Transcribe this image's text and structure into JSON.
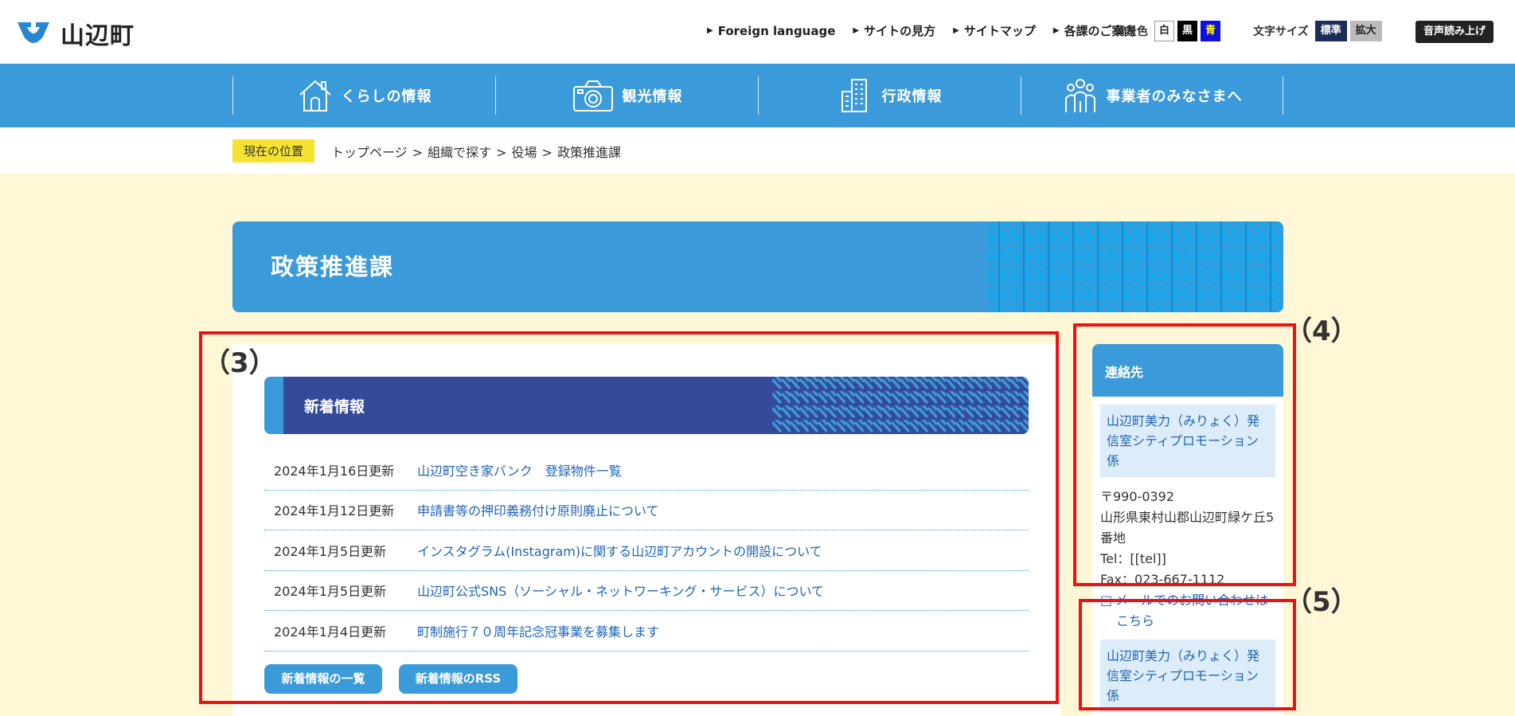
{
  "site": {
    "name": "山辺町"
  },
  "topnav": [
    {
      "label": "Foreign language"
    },
    {
      "label": "サイトの見方"
    },
    {
      "label": "サイトマップ"
    },
    {
      "label": "各課のご案内"
    }
  ],
  "bgcolor": {
    "label": "背景色",
    "white": "白",
    "black": "黒",
    "blue": "青"
  },
  "fontsize": {
    "label": "文字サイズ",
    "standard": "標準",
    "large": "拡大"
  },
  "voice": {
    "label": "音声読み上げ"
  },
  "globalnav": [
    {
      "label": "くらしの情報",
      "icon": "house-icon"
    },
    {
      "label": "観光情報",
      "icon": "camera-icon"
    },
    {
      "label": "行政情報",
      "icon": "building-icon"
    },
    {
      "label": "事業者のみなさまへ",
      "icon": "people-icon"
    }
  ],
  "breadcrumb": {
    "label": "現在の位置",
    "items": [
      "トップページ",
      "組織で探す",
      "役場",
      "政策推進課"
    ],
    "separator": ">"
  },
  "page": {
    "title": "政策推進課"
  },
  "news": {
    "title": "新着情報",
    "items": [
      {
        "date": "2024年1月16日更新",
        "title": "山辺町空き家バンク　登録物件一覧"
      },
      {
        "date": "2024年1月12日更新",
        "title": "申請書等の押印義務付け原則廃止について"
      },
      {
        "date": "2024年1月5日更新",
        "title": "インスタグラム(Instagram)に関する山辺町アカウントの開設について"
      },
      {
        "date": "2024年1月5日更新",
        "title": "山辺町公式SNS（ソーシャル・ネットワーキング・サービス）について"
      },
      {
        "date": "2024年1月4日更新",
        "title": "町制施行７０周年記念冠事業を募集します"
      }
    ],
    "list_button": "新着情報の一覧",
    "rss_button": "新着情報のRSS"
  },
  "contact": {
    "title": "連絡先",
    "org": "山辺町美力（みりょく）発信室シティプロモーション係",
    "postal": "〒990-0392",
    "address": "山形県東村山郡山辺町緑ケ丘5番地",
    "tel": "Tel：[[tel]]",
    "fax": "Fax：023-667-1112",
    "mail_link_a": "メールでのお問い合わせは",
    "mail_link_b": "こちら",
    "org2": "山辺町美力（みりょく）発信室シティプロモーション係"
  },
  "annotations": {
    "a3": "（3）",
    "a4": "（4）",
    "a5": "（5）"
  },
  "colors": {
    "primary": "#3b9ad9",
    "news_header": "#364a9a",
    "highlight": "#f6e330",
    "background": "#fff7d6",
    "annotation": "#ee1111"
  }
}
